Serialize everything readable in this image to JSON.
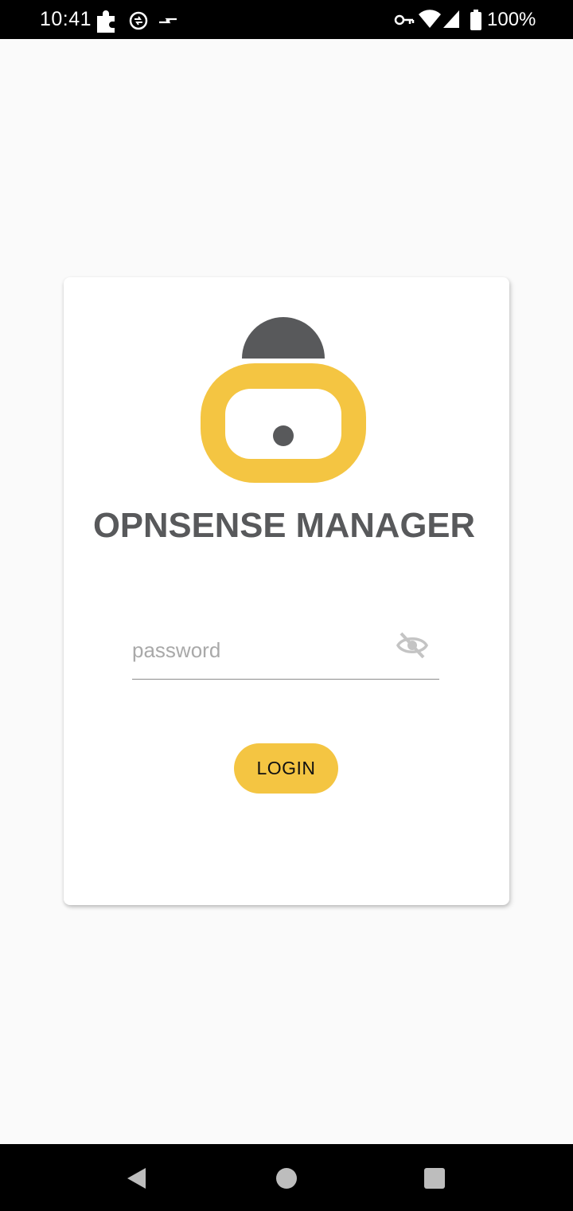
{
  "status_bar": {
    "time": "10:41",
    "battery_text": "100%",
    "left_icons": [
      "puzzle-icon",
      "sync-icon",
      "data-arrows-icon"
    ],
    "right_icons": [
      "vpn-key-icon",
      "wifi-icon",
      "signal-icon",
      "battery-icon"
    ]
  },
  "logo": {
    "brand_text": "OPNSENSE MANAGER",
    "colors": {
      "lock_body": "#f4c542",
      "shackle": "#58595b",
      "text": "#58595b"
    }
  },
  "form": {
    "password_placeholder": "password",
    "password_value": "",
    "visibility_icon": "visibility-off-icon",
    "login_label": "LOGIN"
  },
  "nav_bar": {
    "buttons": [
      "back-icon",
      "home-icon",
      "recents-icon"
    ]
  },
  "colors": {
    "accent": "#f4c542",
    "background": "#fafafa",
    "card": "#ffffff",
    "bars": "#000000"
  }
}
